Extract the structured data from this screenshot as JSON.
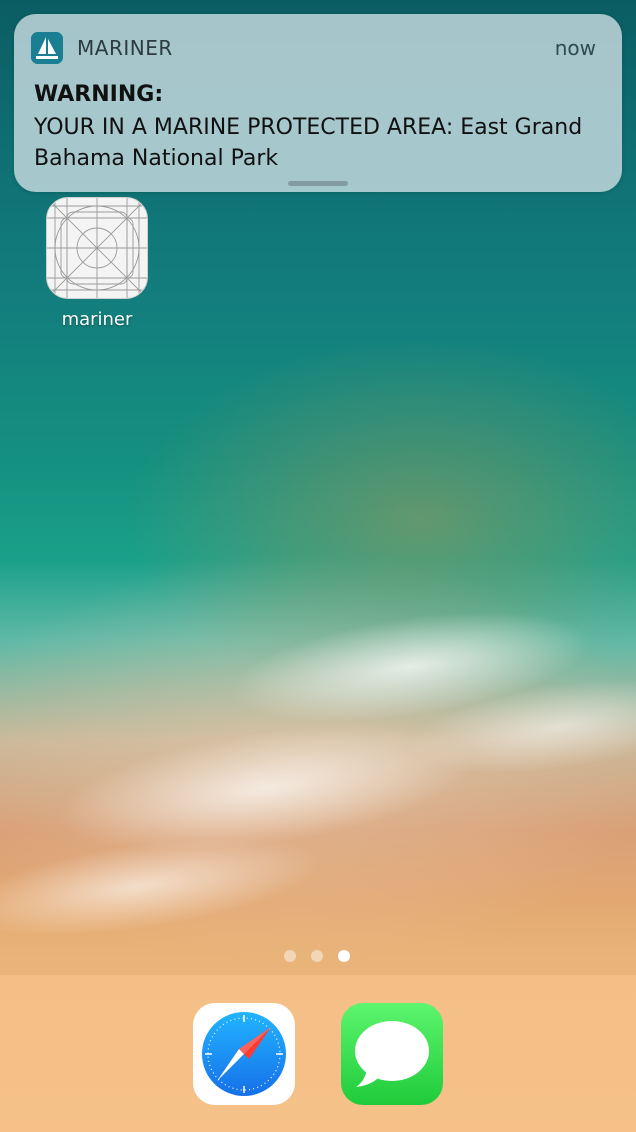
{
  "notification": {
    "app_icon": "mariner-sailboat-icon",
    "app_name": "MARINER",
    "time": "now",
    "title": "WARNING:",
    "body": "YOUR IN A MARINE PROTECTED AREA: East Grand Bahama National Park"
  },
  "home": {
    "apps": [
      {
        "label": "mariner",
        "icon": "app-icon-template-grid-icon"
      }
    ],
    "page_indicator": {
      "pages": 3,
      "current": 3
    }
  },
  "dock": {
    "apps": [
      {
        "name": "Safari",
        "icon": "safari-compass-icon"
      },
      {
        "name": "Messages",
        "icon": "messages-bubble-icon"
      }
    ]
  },
  "colors": {
    "safari_blue": "#1e8ef2",
    "messages_green": "#2bd84a",
    "mariner_teal": "#1a7f93"
  }
}
